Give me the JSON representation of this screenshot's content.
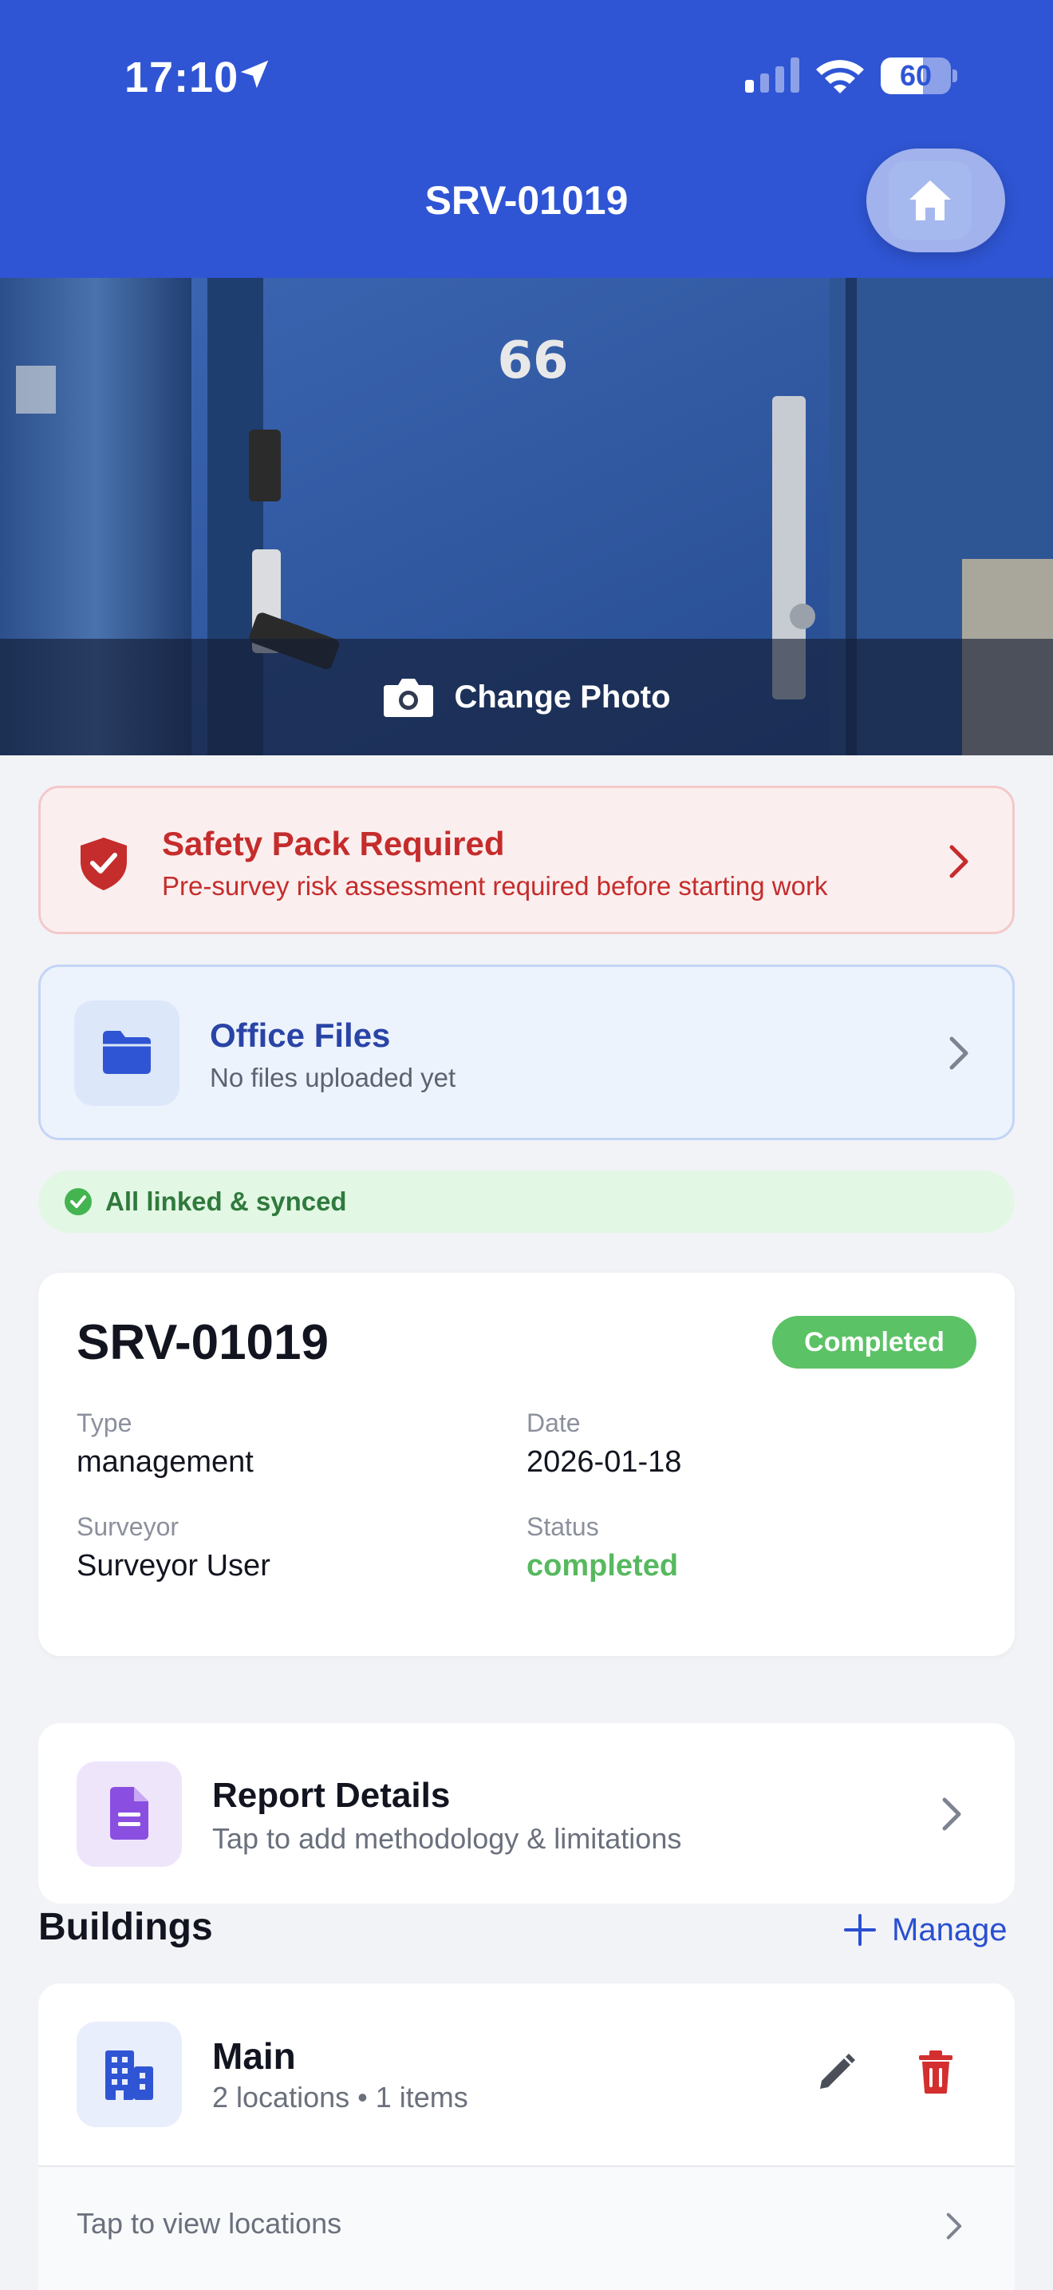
{
  "status_bar": {
    "time": "17:10",
    "battery": "60",
    "battery_level": 0.6
  },
  "nav": {
    "title": "SRV-01019",
    "home_icon": "home-icon"
  },
  "photo": {
    "change_label": "Change Photo",
    "door_number": "66"
  },
  "safety": {
    "title": "Safety Pack Required",
    "subtitle": "Pre-survey risk assessment required before starting work"
  },
  "office_files": {
    "title": "Office Files",
    "subtitle": "No files uploaded yet"
  },
  "sync": {
    "text": "All linked & synced"
  },
  "survey": {
    "title": "SRV-01019",
    "badge": "Completed",
    "type_label": "Type",
    "type_value": "management",
    "date_label": "Date",
    "date_value": "2026-01-18",
    "surveyor_label": "Surveyor",
    "surveyor_value": "Surveyor User",
    "status_label": "Status",
    "status_value": "completed"
  },
  "report": {
    "title": "Report Details",
    "subtitle": "Tap to add methodology & limitations"
  },
  "buildings": {
    "title": "Buildings",
    "manage_label": "Manage",
    "items": [
      {
        "name": "Main",
        "meta": "2 locations • 1 items",
        "view_label": "Tap to view locations"
      }
    ]
  },
  "colors": {
    "header": "#2f55d4",
    "danger": "#c52c2c",
    "success": "#5cc266",
    "accent": "#2a4fd0"
  }
}
